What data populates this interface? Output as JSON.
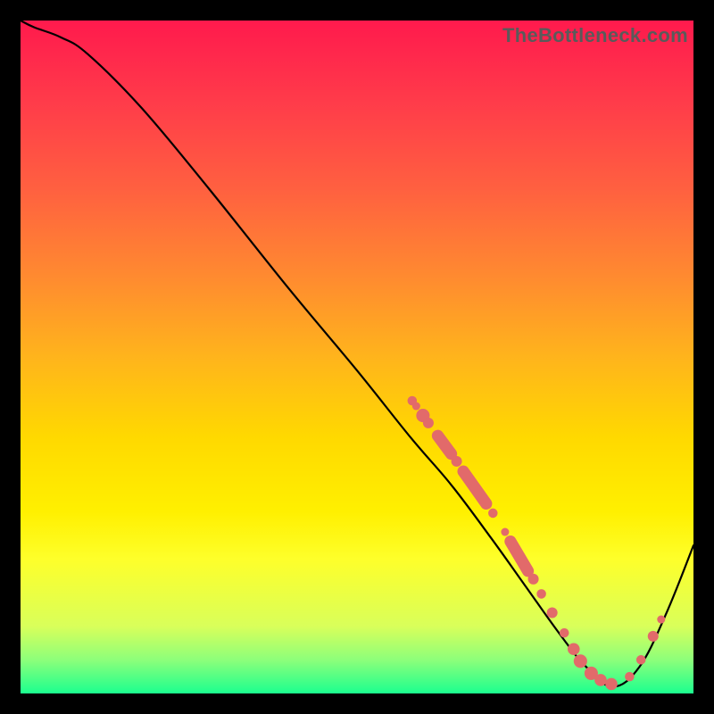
{
  "watermark": "TheBottleneck.com",
  "colors": {
    "dot_fill": "#e26a6a",
    "curve_stroke": "#000000"
  },
  "chart_data": {
    "type": "line",
    "title": "",
    "xlabel": "",
    "ylabel": "",
    "xlim": [
      0,
      100
    ],
    "ylim": [
      0,
      100
    ],
    "grid": false,
    "legend": false,
    "series": [
      {
        "name": "curve",
        "x": [
          0,
          2,
          6,
          10,
          18,
          28,
          40,
          50,
          58,
          64,
          70,
          75,
          80,
          84,
          88,
          92,
          96,
          100
        ],
        "y": [
          100,
          99,
          97.5,
          95,
          87,
          75,
          60,
          48,
          38,
          31,
          23,
          16,
          9,
          4,
          1,
          4,
          12,
          22
        ]
      }
    ],
    "markers": {
      "dots": [
        {
          "x": 58.2,
          "y": 43.5,
          "r": 0.7
        },
        {
          "x": 58.8,
          "y": 42.7,
          "r": 0.6
        },
        {
          "x": 59.8,
          "y": 41.3,
          "r": 1.0
        },
        {
          "x": 60.6,
          "y": 40.2,
          "r": 0.8
        },
        {
          "x": 64.8,
          "y": 34.5,
          "r": 0.8
        },
        {
          "x": 70.2,
          "y": 26.8,
          "r": 0.7
        },
        {
          "x": 72.0,
          "y": 24.0,
          "r": 0.6
        },
        {
          "x": 76.2,
          "y": 17.0,
          "r": 0.8
        },
        {
          "x": 77.4,
          "y": 14.8,
          "r": 0.7
        },
        {
          "x": 79.0,
          "y": 12.0,
          "r": 0.8
        },
        {
          "x": 80.8,
          "y": 9.0,
          "r": 0.7
        },
        {
          "x": 82.2,
          "y": 6.6,
          "r": 0.9
        },
        {
          "x": 83.2,
          "y": 4.8,
          "r": 1.0
        },
        {
          "x": 84.8,
          "y": 3.0,
          "r": 1.0
        },
        {
          "x": 86.2,
          "y": 2.0,
          "r": 0.9
        },
        {
          "x": 87.8,
          "y": 1.4,
          "r": 0.9
        },
        {
          "x": 90.5,
          "y": 2.5,
          "r": 0.7
        },
        {
          "x": 92.2,
          "y": 5.0,
          "r": 0.7
        },
        {
          "x": 94.0,
          "y": 8.5,
          "r": 0.8
        },
        {
          "x": 95.2,
          "y": 11.0,
          "r": 0.6
        }
      ],
      "segments": [
        {
          "x1": 62.0,
          "y1": 38.3,
          "x2": 64.0,
          "y2": 35.6,
          "w": 1.6
        },
        {
          "x1": 65.8,
          "y1": 33.0,
          "x2": 69.2,
          "y2": 28.2,
          "w": 1.6
        },
        {
          "x1": 72.8,
          "y1": 22.6,
          "x2": 75.4,
          "y2": 18.2,
          "w": 1.6
        }
      ]
    }
  }
}
